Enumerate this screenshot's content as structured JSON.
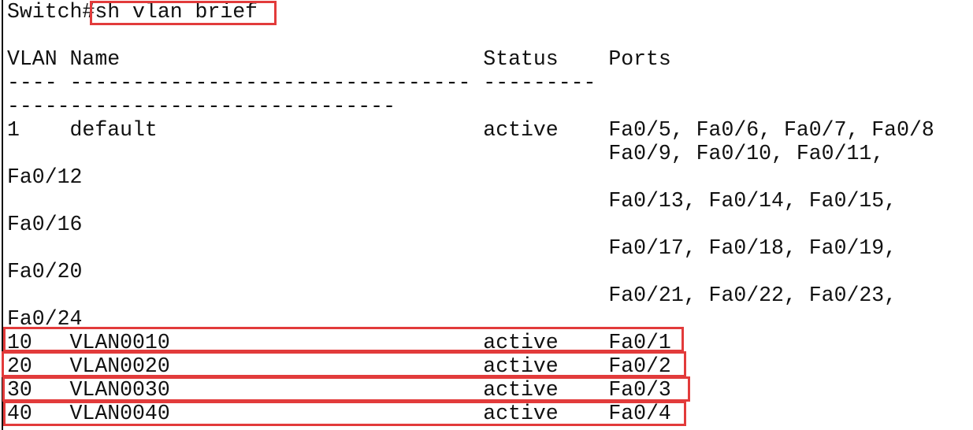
{
  "terminal": {
    "lines": [
      "Switch#sh vlan brief",
      "",
      "VLAN Name                             Status    Ports",
      "---- -------------------------------- ---------",
      "-------------------------------",
      "1    default                          active    Fa0/5, Fa0/6, Fa0/7, Fa0/8",
      "                                                Fa0/9, Fa0/10, Fa0/11,",
      "Fa0/12",
      "                                                Fa0/13, Fa0/14, Fa0/15,",
      "Fa0/16",
      "                                                Fa0/17, Fa0/18, Fa0/19,",
      "Fa0/20",
      "                                                Fa0/21, Fa0/22, Fa0/23,",
      "Fa0/24",
      "10   VLAN0010                         active    Fa0/1",
      "20   VLAN0020                         active    Fa0/2",
      "30   VLAN0030                         active    Fa0/3",
      "40   VLAN0040                         active    Fa0/4"
    ]
  },
  "highlight": {
    "color": "#e23b3b",
    "targets": [
      "command",
      "vlan-10-row",
      "vlan-20-row",
      "vlan-30-row",
      "vlan-40-row"
    ]
  }
}
